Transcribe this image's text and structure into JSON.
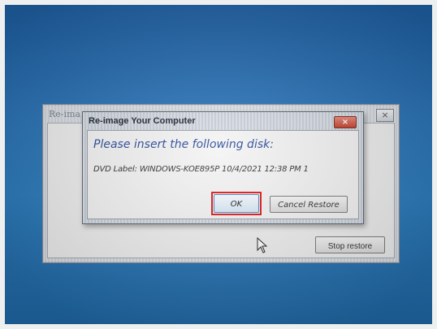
{
  "background_window": {
    "title": "Re-ima",
    "close_glyph": "×",
    "stop_restore_label": "Stop restore"
  },
  "dialog": {
    "title": "Re-image Your Computer",
    "close_glyph": "×",
    "instruction": "Please insert the following disk:",
    "dvd_label_line": "DVD Label: WINDOWS-KOE895P 10/4/2021 12:38 PM  1",
    "ok_label": "OK",
    "cancel_label": "Cancel Restore"
  },
  "colors": {
    "desktop": "#2a74b8",
    "instruction_text": "#2a4b9b",
    "highlight": "#e01919",
    "close_button": "#c4402b"
  },
  "icons": [
    "mouse-pointer-icon",
    "close-icon"
  ]
}
